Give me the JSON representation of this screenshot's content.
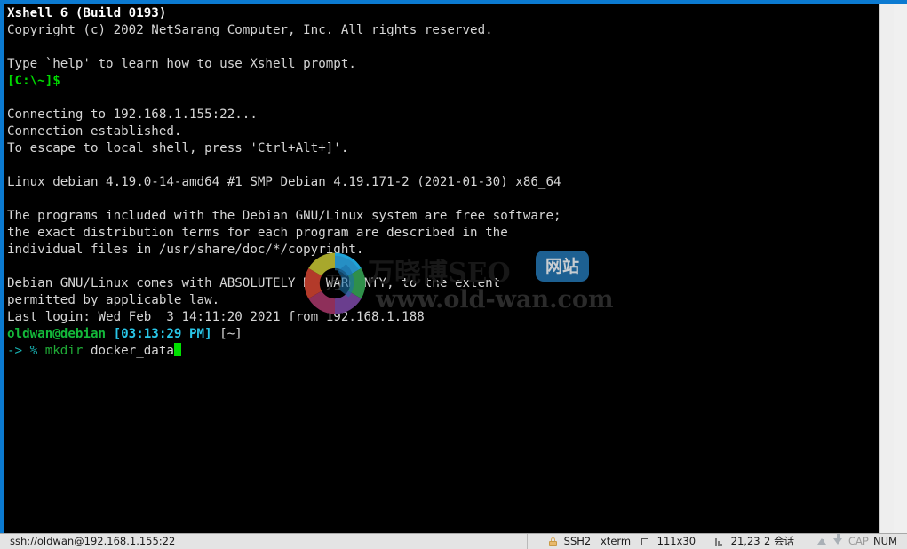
{
  "window": {
    "accent_color": "#0b7ad1",
    "terminal_bg": "#000000"
  },
  "terminal": {
    "lines": [
      {
        "segments": [
          {
            "text": "Xshell 6 (Build 0193)",
            "cls": "c-bold"
          }
        ]
      },
      {
        "segments": [
          {
            "text": "Copyright (c) 2002 NetSarang Computer, Inc. All rights reserved.",
            "cls": "c-white"
          }
        ]
      },
      {
        "segments": [
          {
            "text": "",
            "cls": "c-white"
          }
        ]
      },
      {
        "segments": [
          {
            "text": "Type `help' to learn how to use Xshell prompt.",
            "cls": "c-white"
          }
        ]
      },
      {
        "segments": [
          {
            "text": "[C:\\~]$",
            "cls": "c-green"
          }
        ]
      },
      {
        "segments": [
          {
            "text": "",
            "cls": "c-white"
          }
        ]
      },
      {
        "segments": [
          {
            "text": "Connecting to 192.168.1.155:22...",
            "cls": "c-white"
          }
        ]
      },
      {
        "segments": [
          {
            "text": "Connection established.",
            "cls": "c-white"
          }
        ]
      },
      {
        "segments": [
          {
            "text": "To escape to local shell, press 'Ctrl+Alt+]'.",
            "cls": "c-white"
          }
        ]
      },
      {
        "segments": [
          {
            "text": "",
            "cls": "c-white"
          }
        ]
      },
      {
        "segments": [
          {
            "text": "Linux debian 4.19.0-14-amd64 #1 SMP Debian 4.19.171-2 (2021-01-30) x86_64",
            "cls": "c-white"
          }
        ]
      },
      {
        "segments": [
          {
            "text": "",
            "cls": "c-white"
          }
        ]
      },
      {
        "segments": [
          {
            "text": "The programs included with the Debian GNU/Linux system are free software;",
            "cls": "c-white"
          }
        ]
      },
      {
        "segments": [
          {
            "text": "the exact distribution terms for each program are described in the",
            "cls": "c-white"
          }
        ]
      },
      {
        "segments": [
          {
            "text": "individual files in /usr/share/doc/*/copyright.",
            "cls": "c-white"
          }
        ]
      },
      {
        "segments": [
          {
            "text": "",
            "cls": "c-white"
          }
        ]
      },
      {
        "segments": [
          {
            "text": "Debian GNU/Linux comes with ABSOLUTELY NO WARRANTY, to the extent",
            "cls": "c-white"
          }
        ]
      },
      {
        "segments": [
          {
            "text": "permitted by applicable law.",
            "cls": "c-white"
          }
        ]
      },
      {
        "segments": [
          {
            "text": "Last login: Wed Feb  3 14:11:20 2021 from 192.168.1.188",
            "cls": "c-white"
          }
        ]
      },
      {
        "segments": [
          {
            "text": "oldwan@debian",
            "cls": "c-grn-b"
          },
          {
            "text": " ",
            "cls": "c-white"
          },
          {
            "text": "[03:13:29 PM]",
            "cls": "c-cyanb"
          },
          {
            "text": " [~]",
            "cls": "c-white"
          }
        ]
      },
      {
        "segments": [
          {
            "text": "-> ",
            "cls": "c-cyan"
          },
          {
            "text": "% ",
            "cls": "c-cyan"
          },
          {
            "text": "mkdir",
            "cls": "c-green2"
          },
          {
            "text": " docker_data",
            "cls": "c-white"
          }
        ],
        "cursor": true
      }
    ]
  },
  "watermark": {
    "title": "万晓博SEO",
    "badge": "网站",
    "url": "www.old-wan.com",
    "badge_color": "#1d6092"
  },
  "statusbar": {
    "connection": "ssh://oldwan@192.168.1.155:22",
    "protocol": "SSH2",
    "terminal_type": "xterm",
    "dimensions": "111x30",
    "cursor_position": "21,23",
    "sessions": "2 会话",
    "caps_lock": "CAP",
    "num_lock": "NUM"
  }
}
